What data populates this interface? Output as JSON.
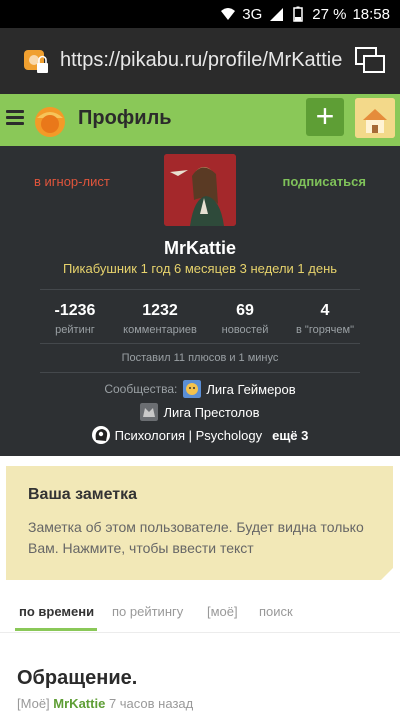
{
  "statusbar": {
    "network": "3G",
    "battery": "27 %",
    "time": "18:58"
  },
  "browser": {
    "url": "https://pikabu.ru/profile/MrKattie"
  },
  "header": {
    "title": "Профиль",
    "add_label": "+"
  },
  "profile": {
    "ignore_label": "в игнор-лист",
    "subscribe_label": "подписаться",
    "username": "MrKattie",
    "tenure": "Пикабушник 1 год 6 месяцев 3 недели 1 день",
    "stats": [
      {
        "value": "-1236",
        "label": "рейтинг"
      },
      {
        "value": "1232",
        "label": "комментариев"
      },
      {
        "value": "69",
        "label": "новостей"
      },
      {
        "value": "4",
        "label": "в \"горячем\""
      }
    ],
    "votes": "Поставил 11 плюсов и 1 минус",
    "communities_label": "Сообщества:",
    "communities": [
      "Лига Геймеров",
      "Лига Престолов",
      "Психология | Psychology"
    ],
    "more_label": "ещё 3"
  },
  "note": {
    "title": "Ваша заметка",
    "text": "Заметка об этом пользователе. Будет видна только Вам. Нажмите, чтобы ввести текст"
  },
  "tabs": [
    "по времени",
    "по рейтингу",
    "[моё]",
    "поиск"
  ],
  "post": {
    "title": "Обращение.",
    "tag": "[Моё]",
    "author": "MrKattie",
    "time": "7 часов назад"
  },
  "colors": {
    "accent": "#8ac858",
    "dark_bg": "#2d3033",
    "note_bg": "#f2e8b7",
    "ignore": "#e0553c"
  }
}
